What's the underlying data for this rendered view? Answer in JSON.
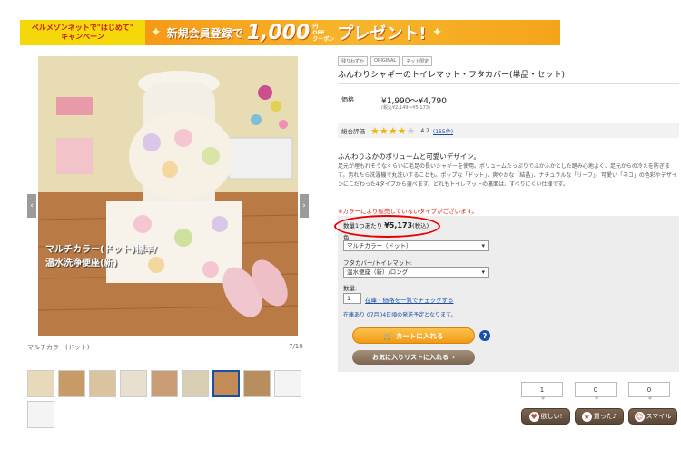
{
  "banner": {
    "left_line1": "ベルメゾンネットで\"はじめて\"",
    "left_line2": "キャンペーン",
    "main": "新規会員登録で",
    "amount": "1,000",
    "unit": "円",
    "off_line1": "OFF",
    "off_line2": "クーポン",
    "present": "プレゼント!"
  },
  "gallery": {
    "prev_arrow": "‹",
    "next_arrow": "›",
    "photo_overlay_line1": "マルチカラー(ドット)標準/",
    "photo_overlay_line2": "温水洗浄便座(新)",
    "caption": "マルチカラー(ドット)",
    "counter": "7/10"
  },
  "product": {
    "tags": [
      "残りわずか",
      "ORIGINAL",
      "ネット限定"
    ],
    "title": "ふんわりシャギーのトイレマット・フタカバー(単品・セット)",
    "price_label": "価格",
    "price": "¥1,990～¥4,790",
    "price_tax": "(税込¥2,149～¥5,173)",
    "rating_label": "総合評価",
    "rating_value": "4.2",
    "rating_count": "(155件)",
    "desc_head": "ふんわりふかのボリュームと可愛いデザイン。",
    "desc": "足元が埋もれそうなくらいに毛足の長いシャギーを使用。ボリュームたっぷりでふかふかとした踏み心地よく、足元からの冷えを防ぎます。汚れたら洗濯機で丸洗いすることも。ポップな「ドット」、爽やかな「結晶」、ナチュラルな「リーフ」、可愛い「ネコ」の色彩やデザインにこだわった4タイプから選べます。どれもトイレマットの裏面は、すべりにくい仕様です。",
    "note": "※カラーにより販売していないタイプがございます。"
  },
  "order": {
    "unit_price_label": "数量1つあたり",
    "unit_price": "¥5,173",
    "unit_price_tax": "(税込)",
    "color_label": "色:",
    "color_value": "マルチカラー（ドット）",
    "type_label": "フタカバー/トイレマット:",
    "type_value": "温水便座（新）/ロング",
    "qty_label": "数量:",
    "qty_value": "1",
    "stock_link": "在庫・価格を一覧でチェックする",
    "shipping": "在庫あり 07月04日頃の発送予定となります。",
    "cart_button": "カートに入れる",
    "help": "?",
    "fav_button": "お気に入りリストに入れる"
  },
  "reactions": [
    {
      "count": "1",
      "label": "欲しい!",
      "icon": "♥"
    },
    {
      "count": "0",
      "label": "買った♪",
      "icon": "★"
    },
    {
      "count": "0",
      "label": "スマイル",
      "icon": "☺"
    }
  ]
}
